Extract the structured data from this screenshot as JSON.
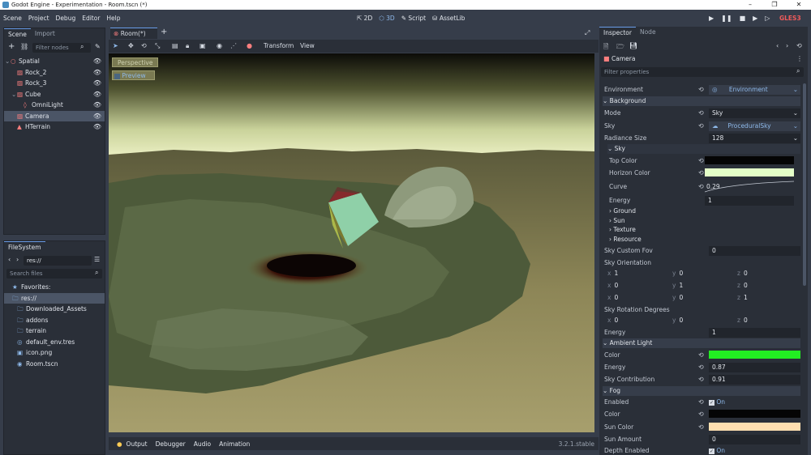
{
  "window": {
    "title": "Godot Engine - Experimentation - Room.tscn (*)",
    "btns": [
      "–",
      "❐",
      "✕"
    ]
  },
  "menu": [
    "Scene",
    "Project",
    "Debug",
    "Editor",
    "Help"
  ],
  "modes": [
    "2D",
    "3D",
    "Script",
    "AssetLib"
  ],
  "renderer": "GLES3",
  "scene_dock": {
    "tabs": [
      "Scene",
      "Import"
    ],
    "filter_placeholder": "Filter nodes",
    "nodes": [
      {
        "label": "Spatial",
        "color": "#fc7f7f",
        "sel": false
      },
      {
        "label": "Rock_2",
        "color": "#fc7f7f",
        "sel": false
      },
      {
        "label": "Rock_3",
        "color": "#fc7f7f",
        "sel": false
      },
      {
        "label": "Cube",
        "color": "#fc7f7f",
        "sel": false
      },
      {
        "label": "OmniLight",
        "color": "#fc7f7f",
        "sel": false
      },
      {
        "label": "Camera",
        "color": "#fc7f7f",
        "sel": true
      },
      {
        "label": "HTerrain",
        "color": "#fc7f7f",
        "sel": false
      }
    ]
  },
  "fs_dock": {
    "tab": "FileSystem",
    "path": "res://",
    "search_placeholder": "Search files",
    "items": [
      "Favorites:",
      "res://",
      "Downloaded_Assets",
      "addons",
      "terrain",
      "default_env.tres",
      "icon.png",
      "Room.tscn"
    ]
  },
  "editor_tabs": {
    "tab": "Room(*)",
    "menus": [
      "Transform",
      "View"
    ],
    "perspective": "Perspective",
    "preview": "Preview"
  },
  "bottom": {
    "tabs": [
      "Output",
      "Debugger",
      "Audio",
      "Animation"
    ],
    "version": "3.2.1.stable"
  },
  "inspector": {
    "tabs": [
      "Inspector",
      "Node"
    ],
    "object": "Camera",
    "filter_placeholder": "Filter properties",
    "environment_label": "Environment",
    "environment_value": "Environment",
    "background": "Background",
    "mode_label": "Mode",
    "mode_value": "Sky",
    "sky_label": "Sky",
    "sky_value": "ProceduralSky",
    "radiance_label": "Radiance Size",
    "radiance_value": "128",
    "sky_sub": "Sky",
    "top_color_label": "Top Color",
    "top_color": "#050505",
    "horizon_color_label": "Horizon Color",
    "horizon_color": "#e4ffc8",
    "curve_label": "Curve",
    "curve_value": "0.29",
    "energy_label": "Energy",
    "energy_value": "1",
    "collapsed": [
      "Ground",
      "Sun",
      "Texture",
      "Resource"
    ],
    "fov_label": "Sky Custom Fov",
    "fov_value": "0",
    "orient_label": "Sky Orientation",
    "orient": [
      [
        "1",
        "0",
        "0"
      ],
      [
        "0",
        "1",
        "0"
      ],
      [
        "0",
        "0",
        "1"
      ]
    ],
    "axes": [
      "x",
      "y",
      "z"
    ],
    "rot_label": "Sky Rotation Degrees",
    "rot": [
      "0",
      "0",
      "0"
    ],
    "energy2_label": "Energy",
    "energy2_value": "1",
    "ambient": "Ambient Light",
    "amb_color_label": "Color",
    "amb_color": "#22ee22",
    "amb_energy_label": "Energy",
    "amb_energy": "0.87",
    "amb_sky_label": "Sky Contribution",
    "amb_sky": "0.91",
    "fog": "Fog",
    "fog_enabled_label": "Enabled",
    "fog_enabled": "On",
    "fog_color_label": "Color",
    "fog_color": "#050505",
    "sun_color_label": "Sun Color",
    "sun_color": "#ffdfb0",
    "sun_amount_label": "Sun Amount",
    "sun_amount": "0",
    "depth_label": "Depth Enabled",
    "depth_value": "On"
  }
}
